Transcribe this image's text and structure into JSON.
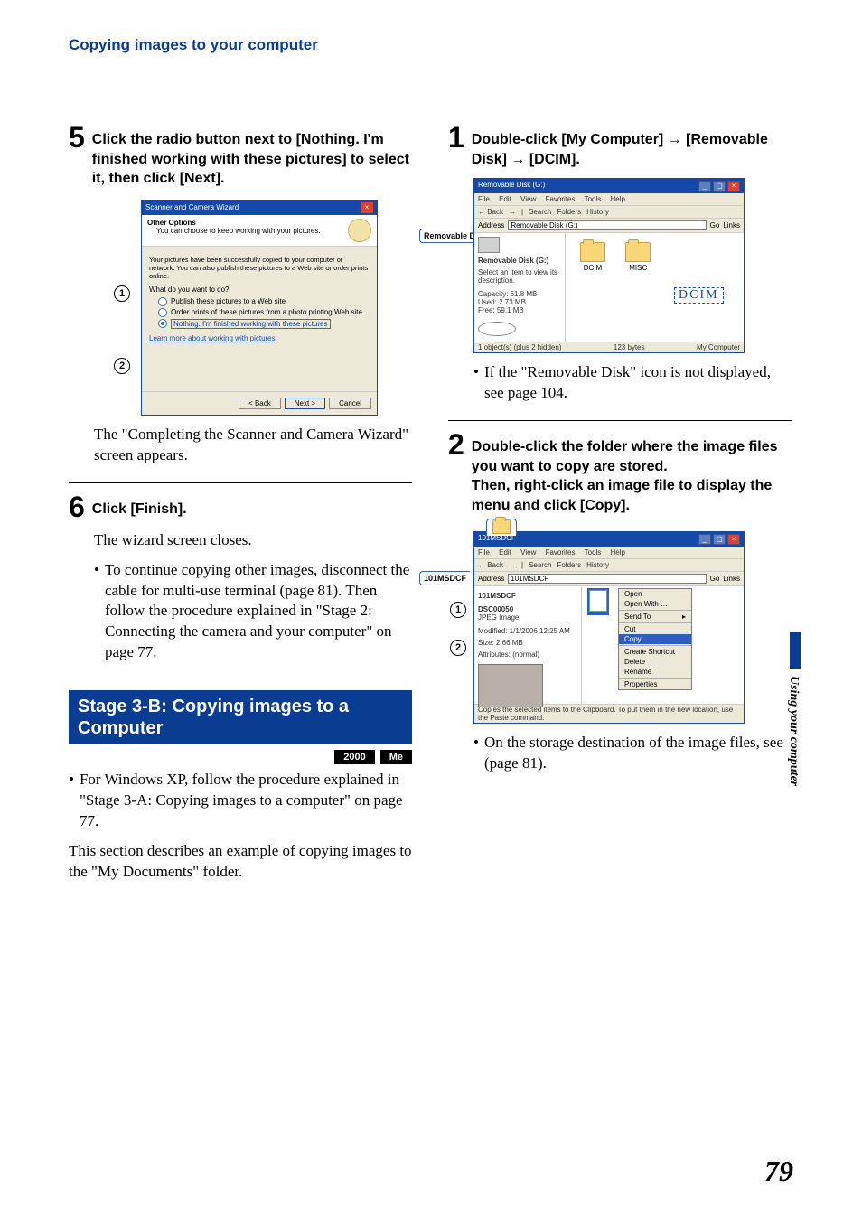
{
  "header": {
    "title": "Copying images to your computer"
  },
  "sideTab": "Using your computer",
  "pageNumber": "79",
  "left": {
    "step5": {
      "num": "5",
      "text": "Click the radio button next to [Nothing. I'm finished working with these pictures] to select it, then click [Next].",
      "after": "The \"Completing the Scanner and Camera Wizard\" screen appears."
    },
    "step6": {
      "num": "6",
      "text": "Click [Finish].",
      "after": "The wizard screen closes.",
      "bullet": "To continue copying other images, disconnect the cable for multi-use terminal (page 81). Then follow the procedure explained in \"Stage 2: Connecting the camera and your computer\" on page 77."
    },
    "stage": {
      "title": "Stage 3-B: Copying images to a Computer",
      "badges": [
        "2000",
        "Me"
      ],
      "bullet": "For Windows XP, follow the procedure explained in \"Stage 3-A: Copying images to a computer\" on page 77.",
      "body": "This section describes an example of copying images to the \"My Documents\" folder."
    }
  },
  "right": {
    "step1": {
      "num": "1",
      "text": "Double-click [My Computer] → [Removable Disk] → [DCIM].",
      "bullet": "If the \"Removable Disk\" icon is not displayed, see page 104."
    },
    "step2": {
      "num": "2",
      "text": "Double-click the folder where the image files you want to copy are stored.\nThen, right-click an image file to display the menu and click [Copy].",
      "bullet": "On the storage destination of the image files, see (page 81)."
    }
  },
  "wizard": {
    "title": "Scanner and Camera Wizard",
    "headTitle": "Other Options",
    "headSub": "You can choose to keep working with your pictures.",
    "msg": "Your pictures have been successfully copied to your computer or network.\nYou can also publish these pictures to a Web site or order prints online.",
    "question": "What do you want to do?",
    "opt1": "Publish these pictures to a Web site",
    "opt2": "Order prints of these pictures from a photo printing Web site",
    "opt3": "Nothing. I'm finished working with these pictures",
    "link": "Learn more about working with pictures",
    "back": "< Back",
    "next": "Next >",
    "cancel": "Cancel"
  },
  "explorer1": {
    "title": "Removable Disk (G:)",
    "menu": [
      "File",
      "Edit",
      "View",
      "Favorites",
      "Tools",
      "Help"
    ],
    "toolBack": "← Back",
    "toolSearch": "Search",
    "toolFolders": "Folders",
    "toolHistory": "History",
    "addrLabel": "Address",
    "addrValue": "Removable Disk (G:)",
    "go": "Go",
    "links": "Links",
    "sideTitle": "Removable Disk (G:)",
    "sideDesc": "Select an item to view its description.",
    "sideCap": "Capacity: 61.8 MB",
    "sideUsed": "Used: 2.73 MB",
    "sideFree": "Free: 59.1 MB",
    "folders": [
      "DCIM",
      "MISC"
    ],
    "dcimLabel": "DCIM",
    "statusL": "1 object(s) (plus 2 hidden)",
    "statusM": "123 bytes",
    "statusR": "My Computer",
    "tabLabel": "Removable Disk"
  },
  "explorer2": {
    "title": "101MSDCF",
    "menu": [
      "File",
      "Edit",
      "View",
      "Favorites",
      "Tools",
      "Help"
    ],
    "toolBack": "← Back",
    "toolSearch": "Search",
    "toolFolders": "Folders",
    "toolHistory": "History",
    "addrLabel": "Address",
    "addrValue": "101MSDCF",
    "go": "Go",
    "links": "Links",
    "sideTitle": "101MSDCF",
    "fileName": "DSC00050",
    "fileType": "JPEG Image",
    "fileMod": "Modified: 1/1/2006 12:25 AM",
    "fileSize": "Size: 2.66 MB",
    "fileAttr": "Attributes: (normal)",
    "status": "Copies the selected items to the Clipboard. To put them in the new location, use the Paste command.",
    "tabLabel": "101MSDCF",
    "ctx": {
      "open": "Open",
      "openWith": "Open With …",
      "sendTo": "Send To",
      "cut": "Cut",
      "copy": "Copy",
      "shortcut": "Create Shortcut",
      "delete": "Delete",
      "rename": "Rename",
      "props": "Properties"
    }
  },
  "callouts": {
    "one": "1",
    "two": "2"
  }
}
